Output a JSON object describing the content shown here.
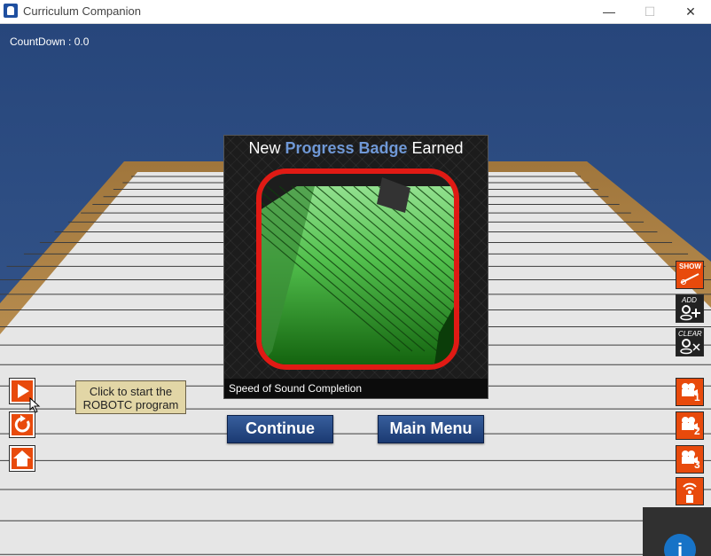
{
  "window": {
    "title": "Curriculum Companion",
    "minimize_icon": "minimize-icon",
    "maximize_icon": "maximize-icon",
    "close_icon": "close-icon",
    "minimize_glyph": "—",
    "maximize_glyph": "☐",
    "close_glyph": "✕"
  },
  "hud": {
    "countdown": "CountDown : 0.0"
  },
  "modal": {
    "title_prefix": "New ",
    "title_highlight": "Progress Badge",
    "title_suffix": " Earned",
    "badge_caption": "Speed of Sound Completion"
  },
  "buttons": {
    "continue": "Continue",
    "main_menu": "Main Menu"
  },
  "left_controls": {
    "tooltip_line1": "Click to start the",
    "tooltip_line2": "ROBOTC program"
  },
  "right_controls": {
    "show_label": "SHOW",
    "add_label": "ADD",
    "clear_label": "CLEAR",
    "camera1": "1",
    "camera2": "2",
    "camera3": "3"
  },
  "info": {
    "glyph": "i"
  },
  "colors": {
    "accent_orange": "#e84a0c",
    "badge_border": "#e01a14",
    "button_blue": "#27497f",
    "sky_blue": "#2e4c80",
    "highlight_blue": "#6f98d6"
  }
}
